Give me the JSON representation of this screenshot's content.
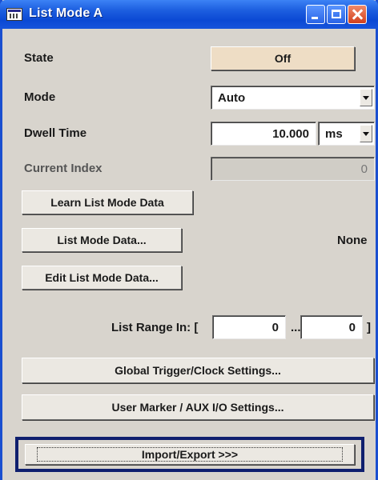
{
  "window": {
    "title": "List Mode  A"
  },
  "state": {
    "label": "State",
    "value": "Off"
  },
  "mode": {
    "label": "Mode",
    "value": "Auto"
  },
  "dwell": {
    "label": "Dwell Time",
    "value": "10.000",
    "unit": "ms"
  },
  "current_index": {
    "label": "Current Index",
    "value": "0"
  },
  "buttons": {
    "learn": "Learn List Mode Data",
    "list_mode_data": "List Mode Data...",
    "edit": "Edit List Mode Data...",
    "global_trigger": "Global Trigger/Clock Settings...",
    "user_marker": "User Marker / AUX I/O Settings...",
    "import_export": "Import/Export >>>"
  },
  "list_mode_data_value": "None",
  "range": {
    "label": "List Range In: [",
    "start": "0",
    "separator": "...",
    "end": "0",
    "close": "]"
  },
  "icons": {
    "app": "list-window-icon",
    "minimize": "minimize-icon",
    "maximize": "maximize-icon",
    "close": "close-icon"
  },
  "colors": {
    "titlebar": "#0b49d4",
    "state_button": "#eeddc5",
    "panel": "#d8d4cd",
    "focus_frame": "#0f1f6e"
  }
}
